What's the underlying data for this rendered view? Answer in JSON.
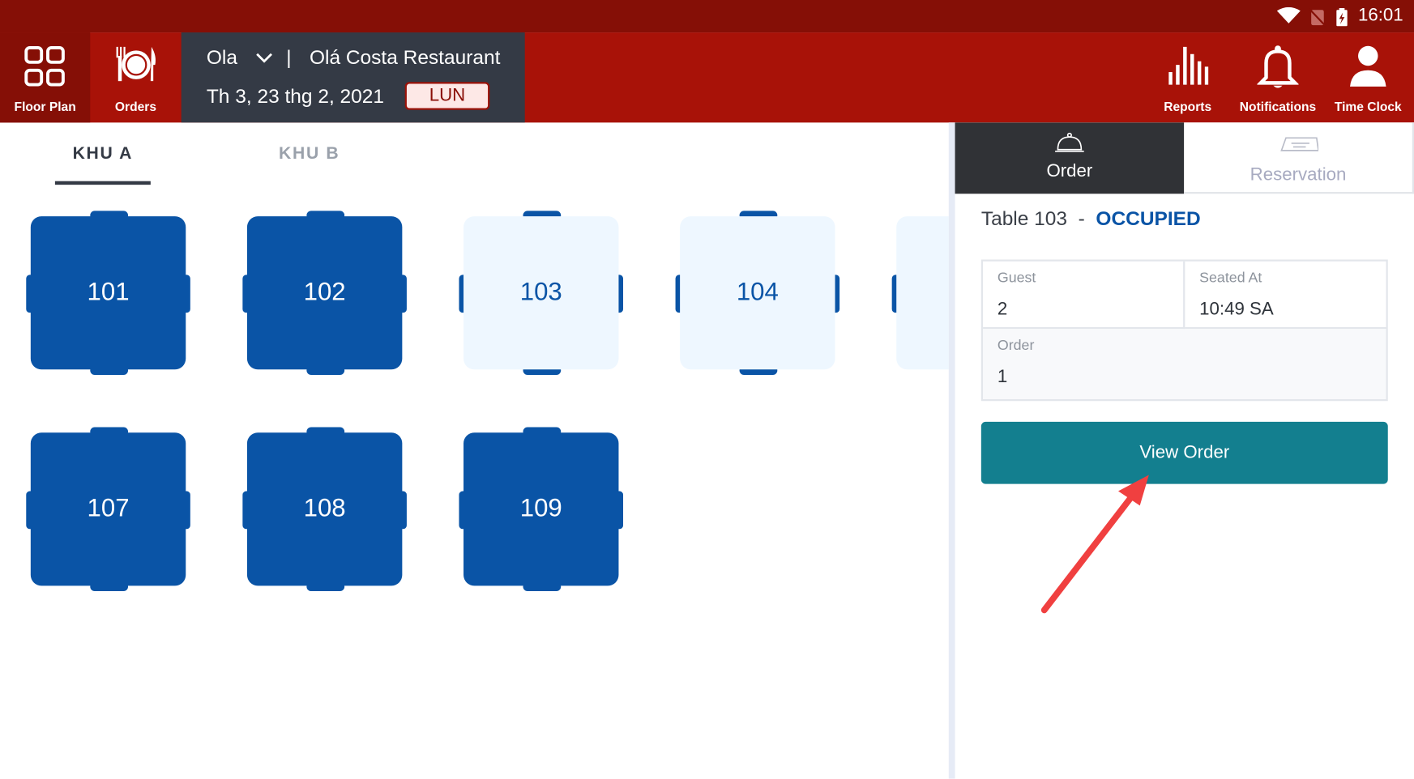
{
  "status_bar": {
    "time": "16:01"
  },
  "nav": {
    "floor_plan": "Floor Plan",
    "orders": "Orders",
    "reports": "Reports",
    "notifications": "Notifications",
    "time_clock": "Time Clock"
  },
  "context": {
    "user": "Ola",
    "separator": "|",
    "restaurant": "Olá Costa Restaurant",
    "date": "Th 3, 23 thg 2, 2021",
    "shift": "LUN"
  },
  "zones": [
    {
      "label": "KHU A",
      "active": true
    },
    {
      "label": "KHU B",
      "active": false
    }
  ],
  "tables": [
    {
      "number": "101",
      "status": "occupied"
    },
    {
      "number": "102",
      "status": "occupied"
    },
    {
      "number": "103",
      "status": "available"
    },
    {
      "number": "104",
      "status": "available"
    },
    {
      "number": "",
      "status": "available"
    },
    {
      "number": "107",
      "status": "occupied"
    },
    {
      "number": "108",
      "status": "occupied"
    },
    {
      "number": "109",
      "status": "occupied"
    }
  ],
  "panel": {
    "tabs": {
      "order": "Order",
      "reservation": "Reservation"
    },
    "table_label": "Table 103",
    "dash": "-",
    "status": "OCCUPIED",
    "guest_label": "Guest",
    "guest_value": "2",
    "seated_label": "Seated At",
    "seated_value": "10:49 SA",
    "order_label": "Order",
    "order_value": "1",
    "view_order": "View Order"
  },
  "colors": {
    "header": "#a81208",
    "status_bar": "#850f06",
    "table_blue": "#0a54a6",
    "button_teal": "#137f8f",
    "annotation_arrow": "#f04040"
  }
}
